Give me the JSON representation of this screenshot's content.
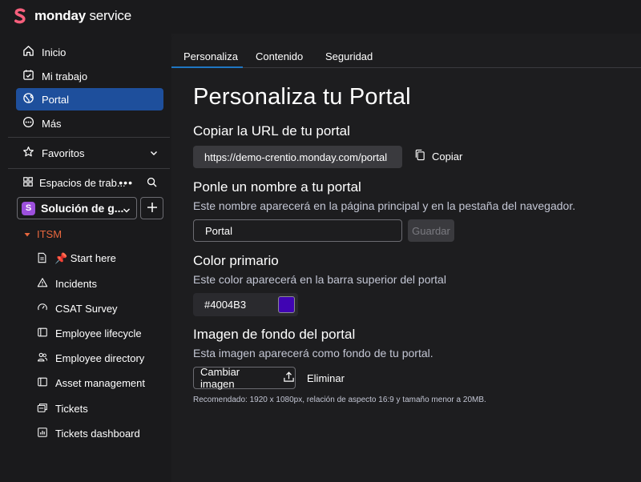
{
  "brand": {
    "name_bold": "monday",
    "name_light": " service"
  },
  "sidebar": {
    "nav": [
      {
        "label": "Inicio",
        "icon": "home-icon"
      },
      {
        "label": "Mi trabajo",
        "icon": "calendar-check-icon"
      },
      {
        "label": "Portal",
        "icon": "globe-icon",
        "active": true
      },
      {
        "label": "Más",
        "icon": "more-circle-icon"
      }
    ],
    "favorites_label": "Favoritos",
    "workspaces_label": "Espacios de trab...",
    "workspace": {
      "badge": "S",
      "name": "Solución de g..."
    },
    "folder": "ITSM",
    "tree": [
      {
        "label": "📌 Start here",
        "icon": "document-icon"
      },
      {
        "label": "Incidents",
        "icon": "warning-icon"
      },
      {
        "label": "CSAT Survey",
        "icon": "gauge-icon"
      },
      {
        "label": "Employee lifecycle",
        "icon": "board-icon"
      },
      {
        "label": "Employee directory",
        "icon": "people-icon"
      },
      {
        "label": "Asset management",
        "icon": "board-icon"
      },
      {
        "label": "Tickets",
        "icon": "tickets-icon"
      },
      {
        "label": "Tickets dashboard",
        "icon": "chart-icon"
      }
    ]
  },
  "main": {
    "tabs": [
      "Personaliza",
      "Contenido",
      "Seguridad"
    ],
    "title": "Personaliza tu Portal",
    "url_section": {
      "heading": "Copiar la URL de tu portal",
      "url": "https://demo-crentio.monday.com/portal",
      "copy_label": "Copiar"
    },
    "name_section": {
      "heading": "Ponle un nombre a tu portal",
      "description": "Este nombre aparecerá en la página principal y en la pestaña del navegador.",
      "value": "Portal",
      "save_label": "Guardar"
    },
    "color_section": {
      "heading": "Color primario",
      "description": "Este color aparecerá en la barra superior del portal",
      "value": "#4004B3"
    },
    "image_section": {
      "heading": "Imagen de fondo del portal",
      "description": "Esta imagen aparecerá como fondo de tu portal.",
      "change_label": "Cambiar imagen",
      "remove_label": "Eliminar",
      "note": "Recomendado: 1920 x 1080px, relación de aspecto 16:9 y tamaño menor a 20MB."
    }
  },
  "colors": {
    "accent": "#1f76c2",
    "active_nav": "#1e4f9c",
    "folder": "#e8673e",
    "primary_swatch": "#4004B3",
    "brand_logo": "#f65f7c"
  }
}
